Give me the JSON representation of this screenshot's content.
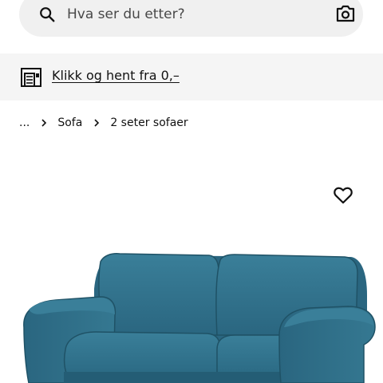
{
  "search": {
    "placeholder": "Hva ser du etter?",
    "icon": "search-icon",
    "camera_icon": "camera-icon"
  },
  "banner": {
    "icon": "store-icon",
    "link_text": "Klikk og hent fra 0,–"
  },
  "breadcrumb": {
    "items": [
      {
        "label": "..."
      },
      {
        "label": "Sofa"
      },
      {
        "label": "2 seter sofaer"
      }
    ]
  },
  "product": {
    "favourite_icon": "heart-outline-icon",
    "image_icon": "sofa-image",
    "colors": {
      "upholstery": "#2f6e87",
      "upholstery_dark": "#1f5266",
      "upholstery_light": "#3a7f99"
    }
  }
}
